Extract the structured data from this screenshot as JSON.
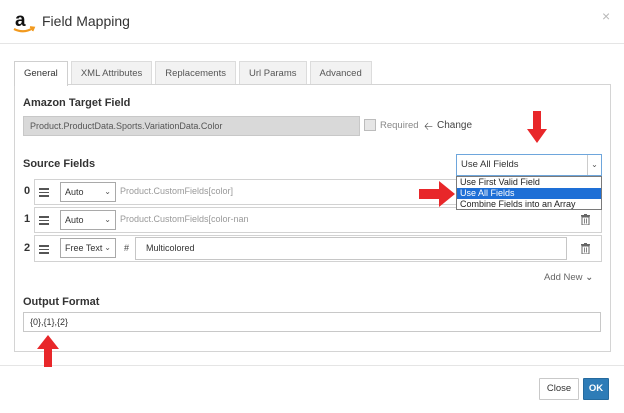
{
  "dialog": {
    "title": "Field Mapping",
    "close_symbol": "×",
    "brand_icon": "amazon-logo-icon"
  },
  "tabs": [
    {
      "label": "General",
      "active": true
    },
    {
      "label": "XML Attributes",
      "active": false
    },
    {
      "label": "Replacements",
      "active": false
    },
    {
      "label": "Url Params",
      "active": false
    },
    {
      "label": "Advanced",
      "active": false
    }
  ],
  "target": {
    "title": "Amazon Target Field",
    "value": "Product.ProductData.Sports.VariationData.Color",
    "required_label": "Required",
    "change_label": "Change"
  },
  "source": {
    "title": "Source Fields",
    "mode_selected": "Use All Fields",
    "mode_options": [
      "Use First Valid Field",
      "Use All Fields",
      "Combine Fields into an Array"
    ],
    "rows": [
      {
        "index": "0",
        "type": "Auto",
        "value": "Product.CustomFields[color]"
      },
      {
        "index": "1",
        "type": "Auto",
        "value": "Product.CustomFields[color-nan"
      },
      {
        "index": "2",
        "type": "Free Text",
        "hash": "#",
        "value": "Multicolored"
      }
    ],
    "add_new_label": "Add New"
  },
  "output": {
    "title": "Output Format",
    "value": "{0},{1},{2}"
  },
  "buttons": {
    "close_label": "Close",
    "ok_label": "OK"
  },
  "colors": {
    "annotation_arrow": "#e8272a",
    "ok_button": "#2e7cb7",
    "selected_option": "#1e6fd6"
  }
}
